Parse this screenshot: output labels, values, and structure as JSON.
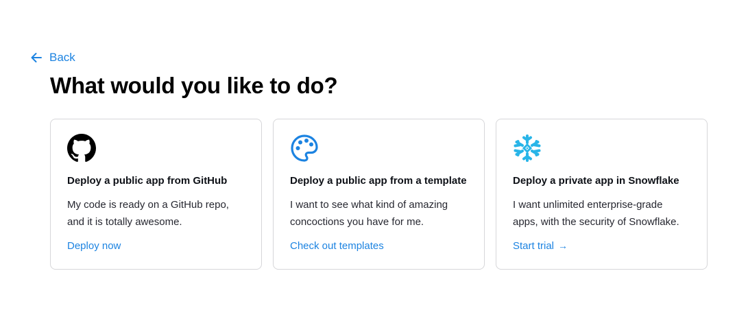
{
  "nav": {
    "back_label": "Back"
  },
  "page": {
    "title": "What would you like to do?"
  },
  "colors": {
    "accent": "#1c83e1",
    "card_border": "#d6d6d9",
    "snowflake": "#29b5e8",
    "template_icon": "#1c83e1"
  },
  "cards": [
    {
      "icon": "github-icon",
      "title": "Deploy a public app from GitHub",
      "description": "My code is ready on a GitHub repo, and it is totally awesome.",
      "link_label": "Deploy now",
      "link_arrow": ""
    },
    {
      "icon": "palette-icon",
      "title": "Deploy a public app from a template",
      "description": "I want to see what kind of amazing concoctions you have for me.",
      "link_label": "Check out templates",
      "link_arrow": ""
    },
    {
      "icon": "snowflake-icon",
      "title": "Deploy a private app in Snowflake",
      "description": "I want unlimited enterprise-grade apps, with the security of Snowflake.",
      "link_label": "Start trial",
      "link_arrow": "→"
    }
  ]
}
